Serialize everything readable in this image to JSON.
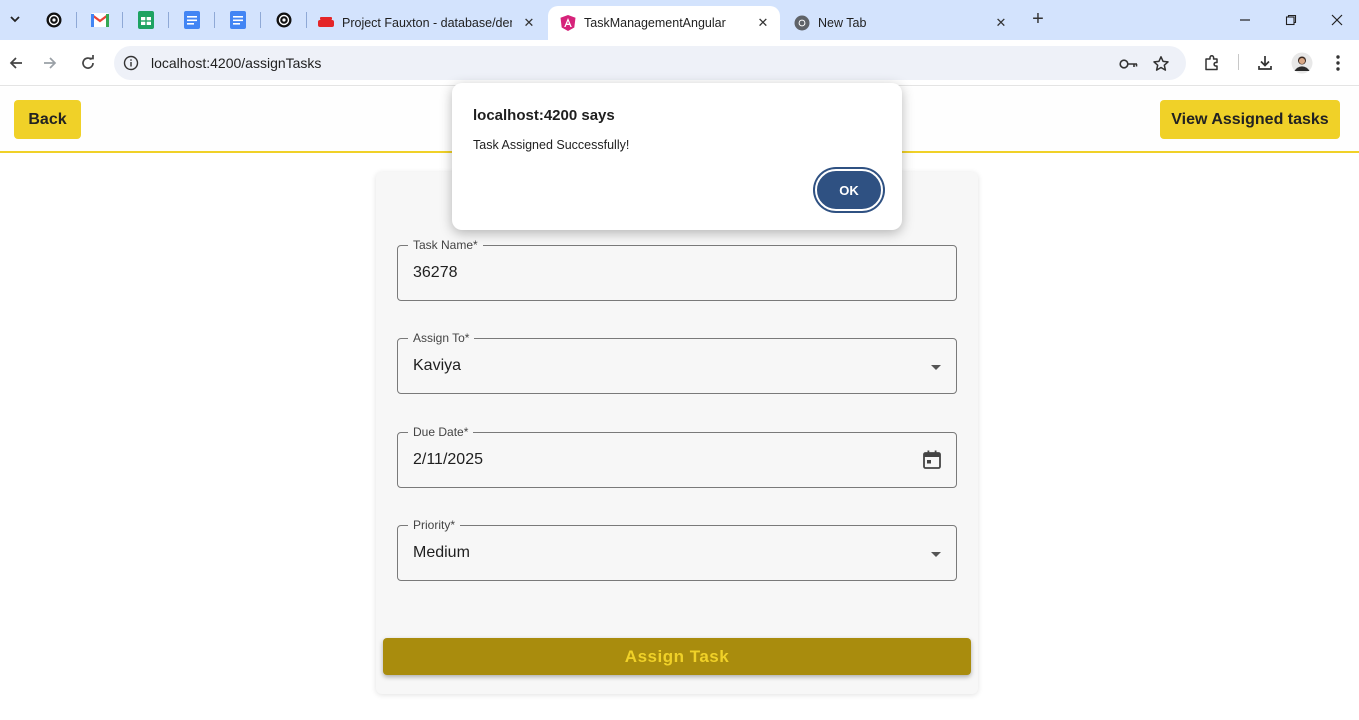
{
  "browser": {
    "tabs": [
      {
        "title": "Project Fauxton - database/dem",
        "icon": "couchdb-icon"
      },
      {
        "title": "TaskManagementAngular",
        "icon": "angular-icon",
        "active": true
      },
      {
        "title": "New Tab",
        "icon": "chrome-icon"
      }
    ],
    "pinned_icons": [
      "openai-icon",
      "gmail-icon",
      "sheets-icon",
      "docs-icon",
      "docs-icon",
      "openai-icon"
    ],
    "url": "localhost:4200/assignTasks"
  },
  "header": {
    "back_label": "Back",
    "view_label": "View Assigned tasks"
  },
  "form": {
    "task_name": {
      "label": "Task Name*",
      "value": "36278"
    },
    "assign_to": {
      "label": "Assign To*",
      "value": "Kaviya"
    },
    "due_date": {
      "label": "Due Date*",
      "value": "2/11/2025"
    },
    "priority": {
      "label": "Priority*",
      "value": "Medium"
    },
    "submit_label": "Assign Task"
  },
  "dialog": {
    "title": "localhost:4200 says",
    "message": "Task Assigned Successfully!",
    "ok_label": "OK"
  },
  "colors": {
    "accent_yellow": "#f0d128",
    "submit_bg": "#a98c0d",
    "dialog_button": "#2f5182",
    "tabstrip": "#d3e3fd"
  }
}
